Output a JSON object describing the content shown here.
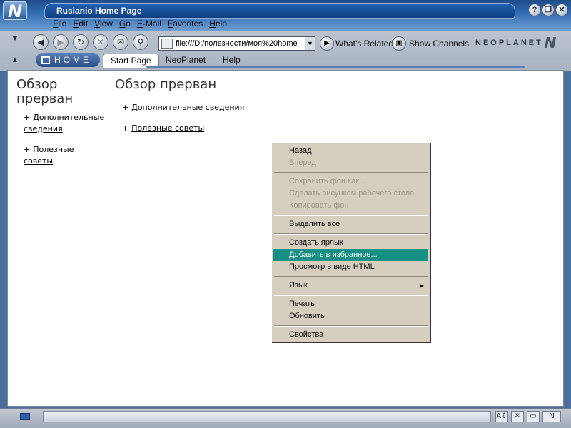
{
  "window": {
    "title": "Ruslanio Home Page",
    "controls": [
      "?",
      "❐",
      "✕"
    ]
  },
  "menu": [
    "File",
    "Edit",
    "View",
    "Go",
    "E-Mail",
    "Favorites",
    "Help"
  ],
  "toolbar": {
    "address": "file:///D:/полезности/моя%20home",
    "whats_related": "What's Related",
    "show_channels": "Show Channels",
    "brand": "NEOPLANET"
  },
  "tabs": {
    "home_label": "HOME",
    "items": [
      "Start Page",
      "NeoPlanet",
      "Help"
    ]
  },
  "content": {
    "left_title": "Обзор прерван",
    "main_title": "Обзор прерван",
    "links": [
      "Дополнительные сведения",
      "Полезные советы"
    ],
    "left_links": [
      {
        "line1": "Дополнительные",
        "line2": "сведения"
      },
      {
        "line1": "Полезные",
        "line2": "советы"
      }
    ],
    "plus": "+"
  },
  "context_menu": [
    {
      "label": "Назад",
      "disabled": false
    },
    {
      "label": "Вперед",
      "disabled": true
    },
    {
      "sep": true
    },
    {
      "label": "Сохранить фон как...",
      "disabled": true
    },
    {
      "label": "Сделать рисунком рабочего стола",
      "disabled": true
    },
    {
      "label": "Копировать фон",
      "disabled": true
    },
    {
      "sep": true
    },
    {
      "label": "Выделить все",
      "disabled": false
    },
    {
      "sep": true
    },
    {
      "label": "Создать ярлык",
      "disabled": false
    },
    {
      "label": "Добавить в избранное...",
      "disabled": false,
      "highlighted": true
    },
    {
      "label": "Просмотр в виде HTML",
      "disabled": false
    },
    {
      "sep": true
    },
    {
      "label": "Язык",
      "disabled": false,
      "submenu": true
    },
    {
      "sep": true
    },
    {
      "label": "Печать",
      "disabled": false
    },
    {
      "label": "Обновить",
      "disabled": false
    },
    {
      "sep": true
    },
    {
      "label": "Свойства",
      "disabled": false
    }
  ],
  "colors": {
    "menu_bg": "#d6cfbf",
    "highlight": "#168f84",
    "title_blue": "#1f5aa8"
  },
  "icons": {
    "back": "back-icon",
    "forward": "forward-icon",
    "refresh": "refresh-icon",
    "stop": "stop-icon",
    "mail": "mail-icon",
    "search": "search-icon"
  }
}
